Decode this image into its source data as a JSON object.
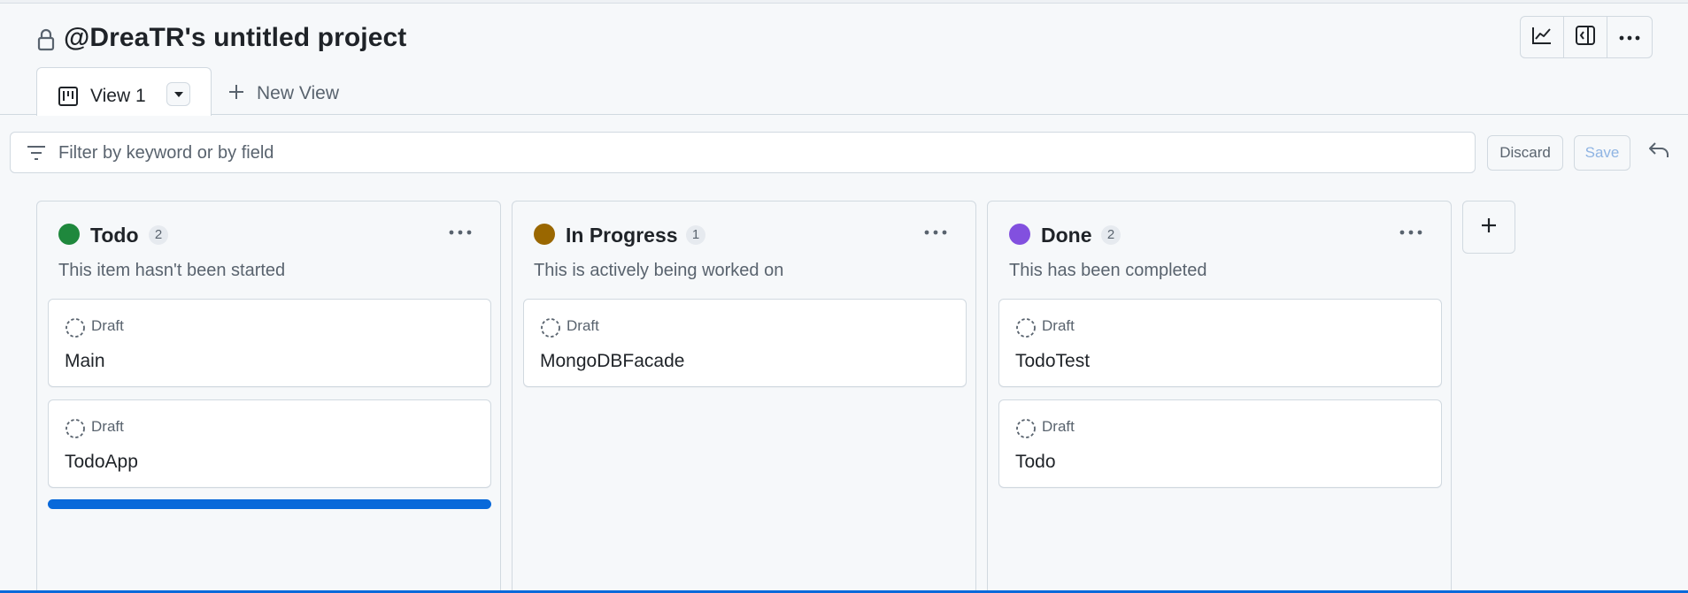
{
  "project": {
    "title": "@DreaTR's untitled project",
    "icons": {
      "private": "lock-icon"
    }
  },
  "toolbar": {
    "buttons": [
      {
        "name": "insights",
        "icon": "graph-icon"
      },
      {
        "name": "layout",
        "icon": "sidebar-expand-icon"
      },
      {
        "name": "more",
        "icon": "kebab-horizontal-icon"
      }
    ]
  },
  "tabs": {
    "active": {
      "label": "View 1",
      "icon": "project-board-icon"
    },
    "new_view_label": "New View"
  },
  "filter": {
    "placeholder": "Filter by keyword or by field",
    "value": "",
    "discard_label": "Discard",
    "save_label": "Save"
  },
  "columns": [
    {
      "name": "Todo",
      "count": "2",
      "description": "This item hasn't been started",
      "color": "#1f883d",
      "cards": [
        {
          "status": "Draft",
          "title": "Main"
        },
        {
          "status": "Draft",
          "title": "TodoApp"
        }
      ]
    },
    {
      "name": "In Progress",
      "count": "1",
      "description": "This is actively being worked on",
      "color": "#9a6700",
      "cards": [
        {
          "status": "Draft",
          "title": "MongoDBFacade"
        }
      ]
    },
    {
      "name": "Done",
      "count": "2",
      "description": "This has been completed",
      "color": "#8250df",
      "cards": [
        {
          "status": "Draft",
          "title": "TodoTest"
        },
        {
          "status": "Draft",
          "title": "Todo"
        }
      ]
    }
  ],
  "colors": {
    "accent": "#0969da",
    "border": "#d1d9e0",
    "muted_text": "#59636e"
  }
}
